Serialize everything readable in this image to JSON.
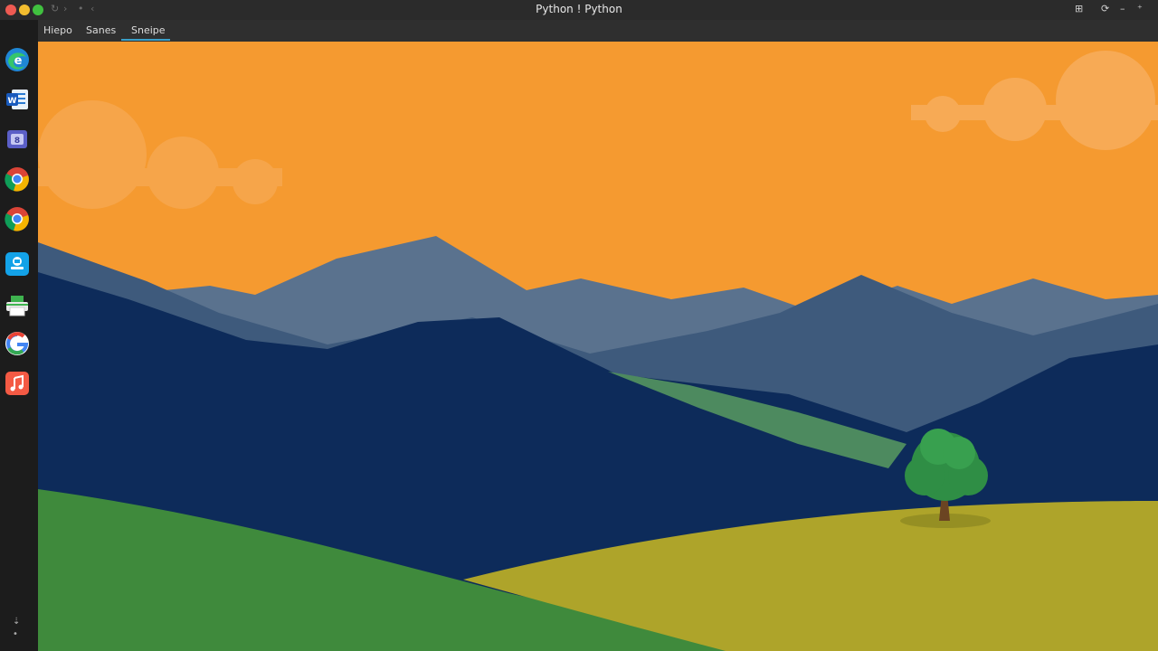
{
  "window": {
    "title": "Python ! Python",
    "nav_back": "↻",
    "nav_fwd": "›",
    "nav_more": "‹",
    "nav_dot": "•"
  },
  "tabs": [
    {
      "label": "Hiepo"
    },
    {
      "label": "Sanes"
    },
    {
      "label": "Sneipe"
    }
  ],
  "toolbar": {
    "icons": [
      "window-icon",
      "refresh-icon",
      "minimize-icon",
      "settings-icon"
    ],
    "icon_glyphs": [
      "⊞",
      "⟳",
      "–",
      "⁺"
    ]
  },
  "dock": {
    "apps": [
      "edge-icon",
      "word-icon",
      "teams-icon",
      "chrome-icon",
      "chrome-icon",
      "app-store-icon",
      "printer-icon",
      "google-icon",
      "music-icon"
    ],
    "bottom_glyphs": [
      "⇣",
      "•"
    ]
  },
  "colors": {
    "sky": "#f59a30",
    "mountain_far": "#5a728e",
    "mountain_mid": "#3e5a7c",
    "mountain_near": "#0d2b5a",
    "hill_green": "#3f8a3c",
    "hill_yellow": "#aea42a",
    "tree": "#2f8e45"
  }
}
